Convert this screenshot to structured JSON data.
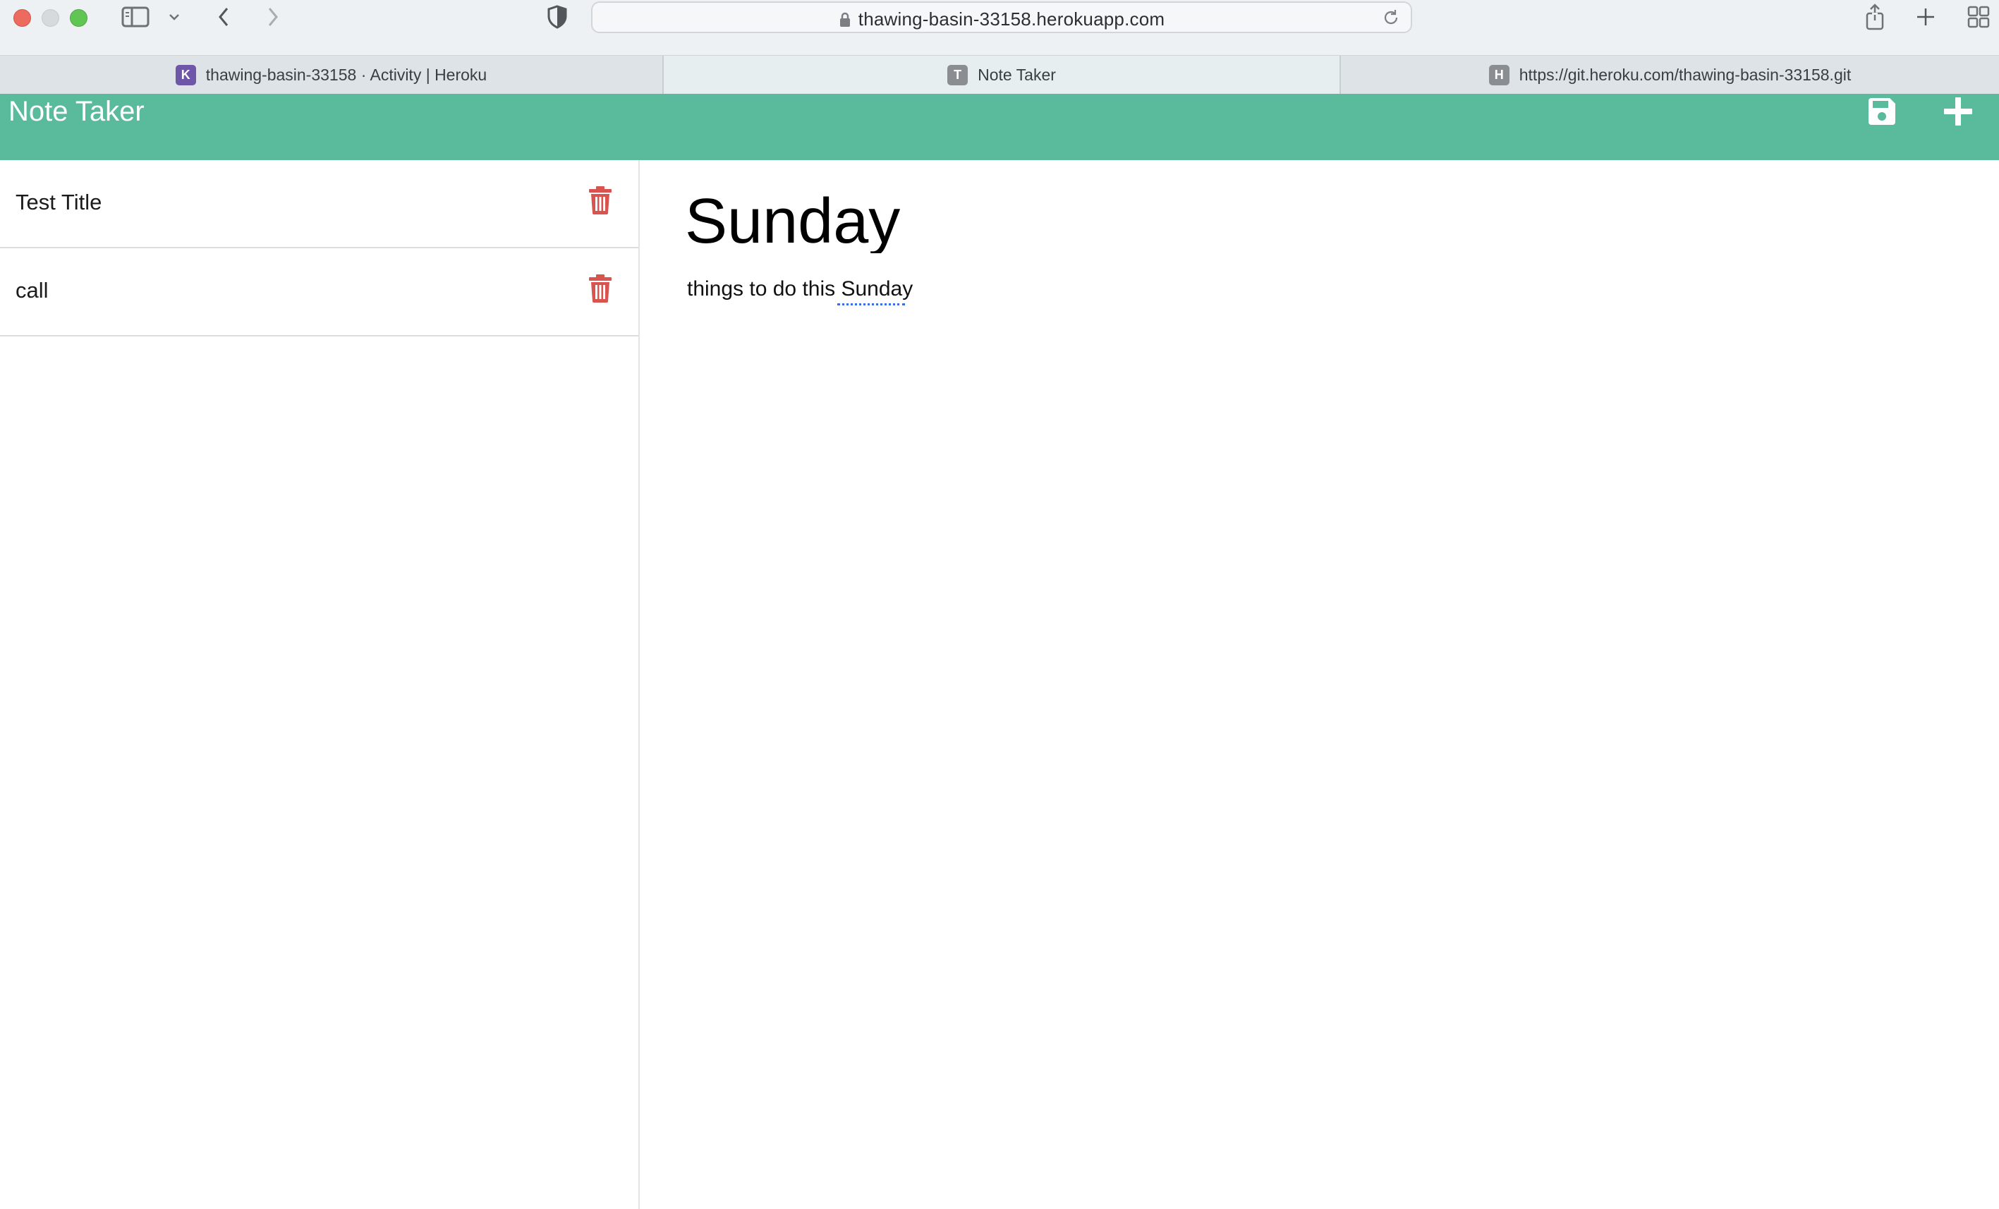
{
  "browser": {
    "url": "thawing-basin-33158.herokuapp.com",
    "tabs": [
      {
        "label": "thawing-basin-33158 · Activity | Heroku",
        "favicon_letter": "K",
        "favicon_color": "#6e56a9"
      },
      {
        "label": "Note Taker",
        "favicon_letter": "T",
        "favicon_color": "#8a8e92"
      },
      {
        "label": "https://git.heroku.com/thawing-basin-33158.git",
        "favicon_letter": "H",
        "favicon_color": "#8a8e92"
      }
    ]
  },
  "app": {
    "title": "Note Taker",
    "accent_color": "#59ba9c",
    "icons": {
      "save": "save-icon",
      "new": "plus-icon",
      "delete": "trash-icon"
    }
  },
  "notes": [
    {
      "title": "Test Title"
    },
    {
      "title": "call"
    }
  ],
  "active_note": {
    "title": "Sunday",
    "text": "things to do this Sunday"
  }
}
